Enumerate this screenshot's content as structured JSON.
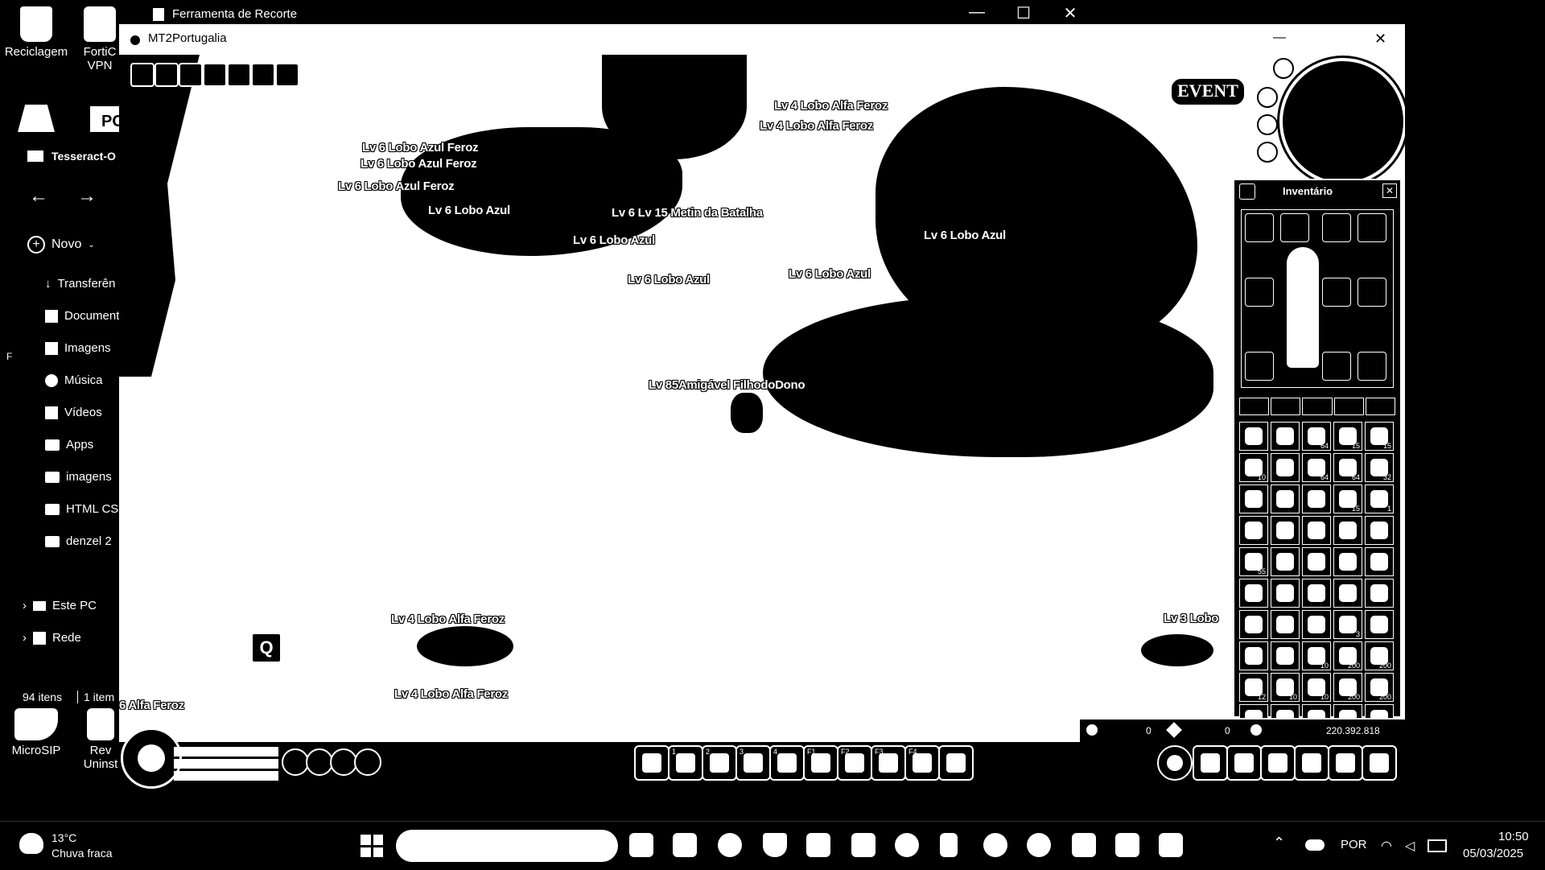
{
  "desktop": {
    "icons": [
      {
        "label": "Reciclagem"
      },
      {
        "label": "FortiC\nVPN"
      },
      {
        "label": "MicroSIP"
      },
      {
        "label": "Rev\nUninst"
      }
    ]
  },
  "explorer": {
    "tab_label": "Tesseract-O",
    "new_label": "Novo",
    "nav": [
      "Transferên",
      "Document",
      "Imagens",
      "Música",
      "Vídeos",
      "Apps",
      "imagens",
      "HTML CSS",
      "denzel 2",
      "Este PC",
      "Rede"
    ],
    "status_count": "94 itens",
    "status_selected": "1 item",
    "side_char": "F"
  },
  "snipping_tool": {
    "title": "Ferramenta de Recorte",
    "minimize": "—",
    "maximize": "☐",
    "close": "✕"
  },
  "game": {
    "window_title": "MT2Portugalia",
    "minimize": "—",
    "close": "✕",
    "event_button": "EVENT",
    "labels": [
      "Lv 4 Lobo Alfa Feroz",
      "Lv 4 Lobo Alfa Feroz",
      "Lv 6 Lobo Azul Feroz",
      "Lv 6 Lobo Azul Feroz",
      "Lv 6 Lobo Azul Feroz",
      "Lv 6 Lobo Azul",
      "Lv 6 Lv 15 Metin da Batalha",
      "Lv 6 Lobo Azul",
      "Lv 6 Lobo Azul",
      "Lv 6 Lobo Azul",
      "Lv 6 Lobo Azul",
      "Lv 85Amigável  FilhodoDono",
      "Lv 4 Lobo Alfa Feroz",
      "Lv 4 Lobo Alfa Feroz",
      "Lv 3 Lobo",
      "6 Alfa Feroz"
    ],
    "q_key": "Q",
    "inventory": {
      "title": "Inventário",
      "close": "✕",
      "quantities": [
        "",
        "",
        "64",
        "15",
        "15",
        "10",
        "",
        "64",
        "64",
        "32",
        "",
        "",
        "",
        "15",
        "1",
        "",
        "",
        "",
        "",
        "",
        "55",
        "",
        "",
        "",
        "",
        "",
        "",
        "",
        "",
        "",
        "",
        "",
        "",
        "3",
        "",
        "",
        "",
        "10",
        "200",
        "200",
        "12",
        "10",
        "10",
        "200",
        "200",
        "",
        "",
        "",
        "200",
        "200"
      ]
    },
    "money": {
      "left_value": "0",
      "mid_value": "0",
      "gold": "220.392.818"
    },
    "hotbar_keys": [
      "",
      "1",
      "2",
      "3",
      "4",
      "F1",
      "F2",
      "F3",
      "F4",
      ""
    ]
  },
  "taskbar": {
    "weather_temp": "13°C",
    "weather_desc": "Chuva fraca",
    "language": "POR",
    "time": "10:50",
    "date": "05/03/2025"
  }
}
